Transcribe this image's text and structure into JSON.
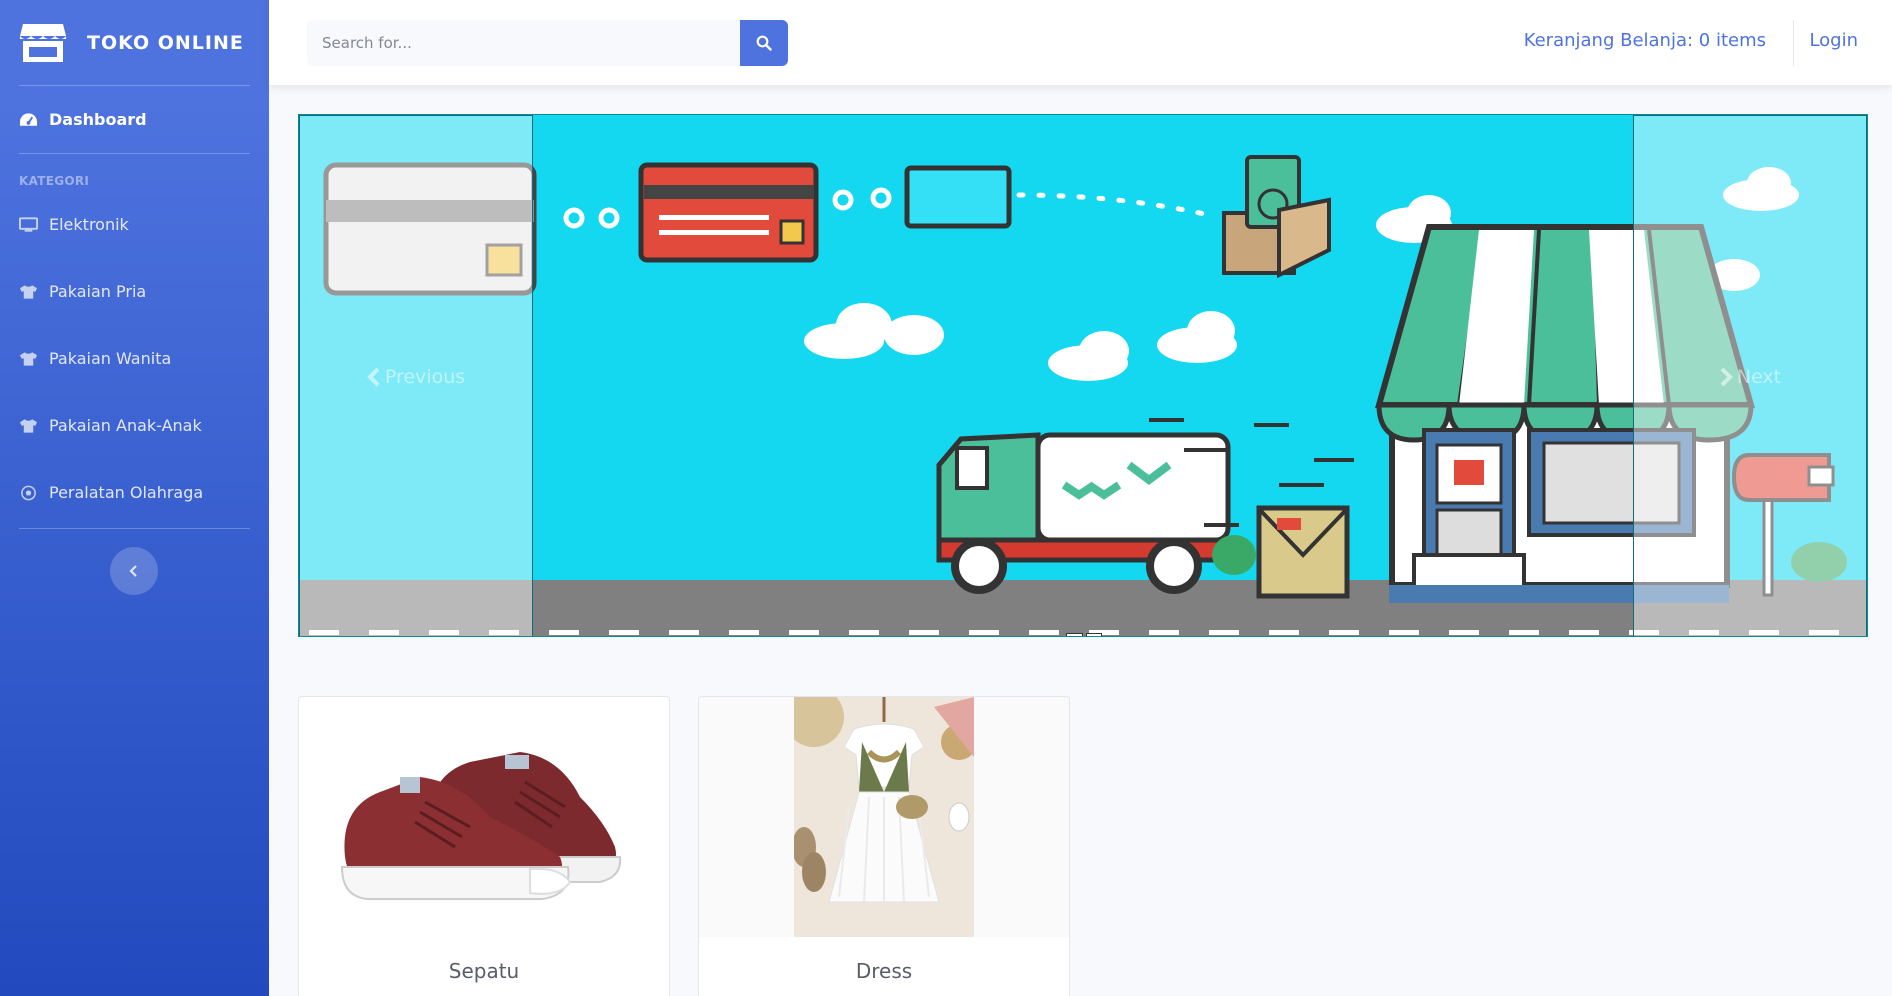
{
  "brand": {
    "name": "TOKO ONLINE",
    "icon": "store-icon"
  },
  "sidebar": {
    "dashboard": {
      "label": "Dashboard",
      "icon": "tachometer-icon"
    },
    "heading": "KATEGORI",
    "items": [
      {
        "label": "Elektronik",
        "icon": "desktop-icon"
      },
      {
        "label": "Pakaian Pria",
        "icon": "tshirt-icon"
      },
      {
        "label": "Pakaian Wanita",
        "icon": "tshirt-icon"
      },
      {
        "label": "Pakaian Anak-Anak",
        "icon": "tshirt-icon"
      },
      {
        "label": "Peralatan Olahraga",
        "icon": "football-icon"
      }
    ],
    "toggle_icon": "chevron-left-icon"
  },
  "topbar": {
    "search_placeholder": "Search for...",
    "search_icon": "search-icon",
    "cart_label": "Keranjang Belanja: 0 items",
    "login_label": "Login"
  },
  "carousel": {
    "prev_label": "Previous",
    "next_label": "Next",
    "slide_count": 2
  },
  "products": [
    {
      "name": "Sepatu"
    },
    {
      "name": "Dress"
    }
  ],
  "colors": {
    "primary": "#4e73df",
    "sky": "#14d7f0",
    "road": "#808080"
  }
}
